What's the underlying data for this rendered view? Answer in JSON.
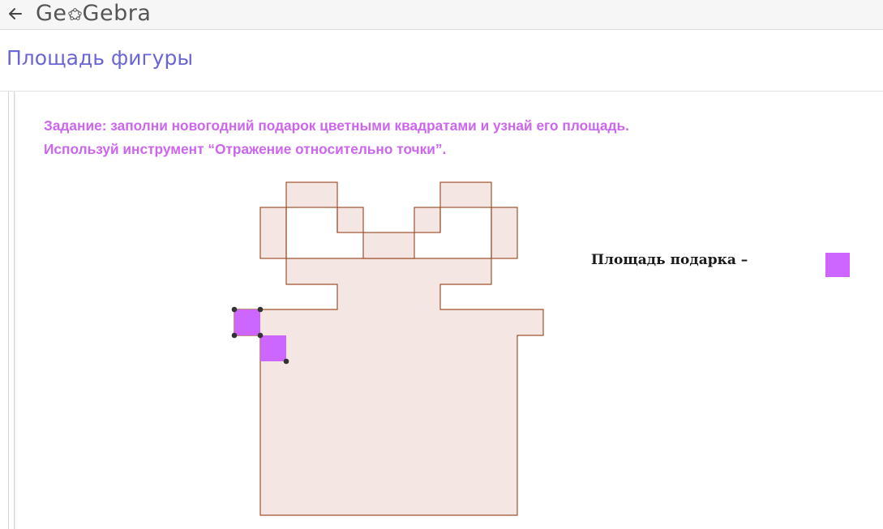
{
  "header": {
    "app_name": "GeoGebra",
    "back_label": "←"
  },
  "page": {
    "title": "Площадь фигуры"
  },
  "applet": {
    "task_line_1": "Задание: заполни новогодний подарок цветными квадратами и узнай его площадь.",
    "task_line_2": "Используй инструмент “Отражение относительно точки”.",
    "area_label": "Площадь подарка –"
  },
  "colors": {
    "brand_title": "#6a65d8",
    "task_text": "#cc66ee",
    "shape_fill": "#f3e6e3",
    "shape_stroke": "#a0522d",
    "square_fill": "#cc66ff",
    "point": "#333333"
  }
}
